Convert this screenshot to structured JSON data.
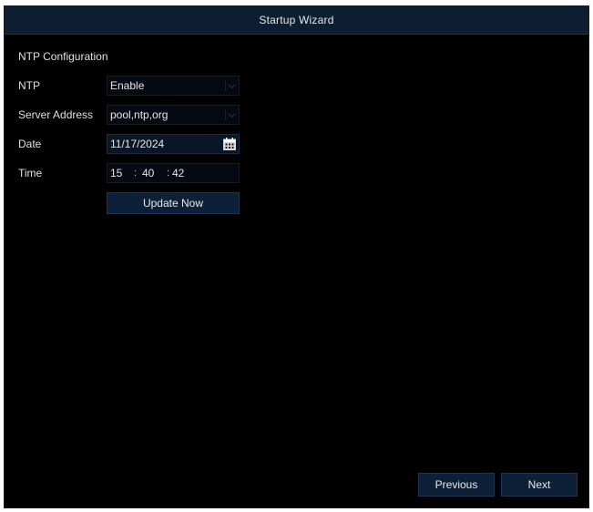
{
  "window": {
    "title": "Startup Wizard"
  },
  "ntp_config": {
    "section_title": "NTP Configuration",
    "ntp": {
      "label": "NTP",
      "value": "Enable"
    },
    "server": {
      "label": "Server Address",
      "value": "pool,ntp,org"
    },
    "date": {
      "label": "Date",
      "value": "11/17/2024",
      "icon": "calendar-icon"
    },
    "time": {
      "label": "Time",
      "hour": "15",
      "minute": "40",
      "second": "42",
      "separator": ":"
    },
    "update_button": "Update Now"
  },
  "footer": {
    "previous_label": "Previous",
    "next_label": "Next"
  },
  "colors": {
    "background": "#000000",
    "title_bar": "#0d1e33",
    "button": "#0d2038",
    "text": "#e8e8e8"
  }
}
